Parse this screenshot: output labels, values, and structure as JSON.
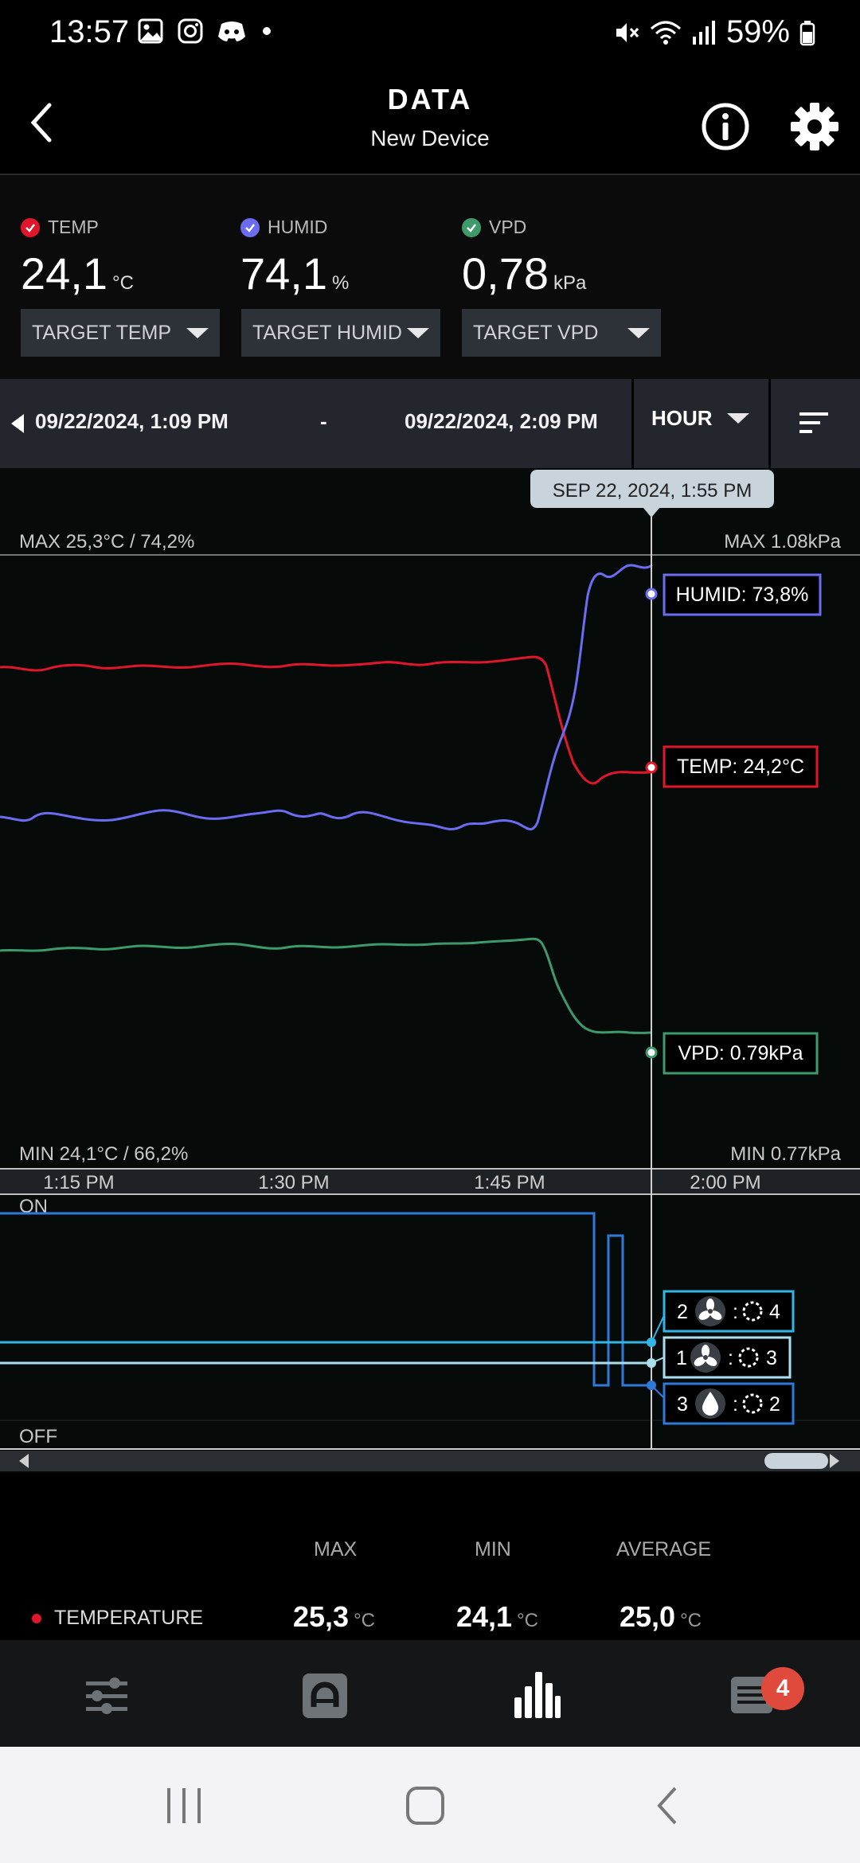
{
  "status_bar": {
    "time": "13:57",
    "battery": "59%",
    "icons_left": [
      "gallery-icon",
      "instagram-icon",
      "discord-icon",
      "dot-icon"
    ],
    "icons_right": [
      "mute-icon",
      "wifi-icon",
      "signal-icon",
      "battery-icon"
    ]
  },
  "header": {
    "title": "DATA",
    "subtitle": "New Device"
  },
  "readings": [
    {
      "label": "TEMP",
      "value": "24,1",
      "unit": "°C",
      "color": "#e0162b",
      "target_label": "TARGET TEMP"
    },
    {
      "label": "HUMID",
      "value": "74,1",
      "unit": "%",
      "color": "#6b6cf0",
      "target_label": "TARGET HUMID"
    },
    {
      "label": "VPD",
      "value": "0,78",
      "unit": "kPa",
      "color": "#3d9a6a",
      "target_label": "TARGET VPD"
    }
  ],
  "range": {
    "start": "09/22/2024, 1:09 PM",
    "separator": "-",
    "end": "09/22/2024, 2:09 PM",
    "interval": "HOUR"
  },
  "chart": {
    "cursor_label": "SEP 22, 2024, 1:55 PM",
    "max_left": "MAX 25,3°C / 74,2%",
    "max_right": "MAX 1.08kPa",
    "min_left": "MIN 24,1°C / 66,2%",
    "min_right": "MIN 0.77kPa",
    "humid_tooltip": "HUMID: 73,8%",
    "temp_tooltip": "TEMP: 24,2°C",
    "vpd_tooltip": "VPD: 0.79kPa",
    "time_ticks": [
      "1:15 PM",
      "1:30 PM",
      "1:45 PM",
      "2:00 PM"
    ],
    "on_label": "ON",
    "off_label": "OFF",
    "devices": [
      {
        "port": "2",
        "type": "fan-icon",
        "sep": ":",
        "level": "4",
        "color": "#33b5e5"
      },
      {
        "port": "1",
        "type": "fan-icon",
        "sep": ":",
        "level": "3",
        "color": "#a9dfef"
      },
      {
        "port": "3",
        "type": "drop-icon",
        "sep": ":",
        "level": "2",
        "color": "#2f7ad9"
      }
    ],
    "colors": {
      "temp": "#e0162b",
      "humid": "#6b6cf0",
      "vpd": "#3d9a6a"
    }
  },
  "summary": {
    "headers": [
      "MAX",
      "MIN",
      "AVERAGE"
    ],
    "row_label": "TEMPERATURE",
    "max": "25,3",
    "min": "24,1",
    "avg": "25,0",
    "unit": "°C"
  },
  "tabs": {
    "badge": "4",
    "items": [
      "controls-tab",
      "automation-tab",
      "data-tab",
      "log-tab"
    ]
  }
}
